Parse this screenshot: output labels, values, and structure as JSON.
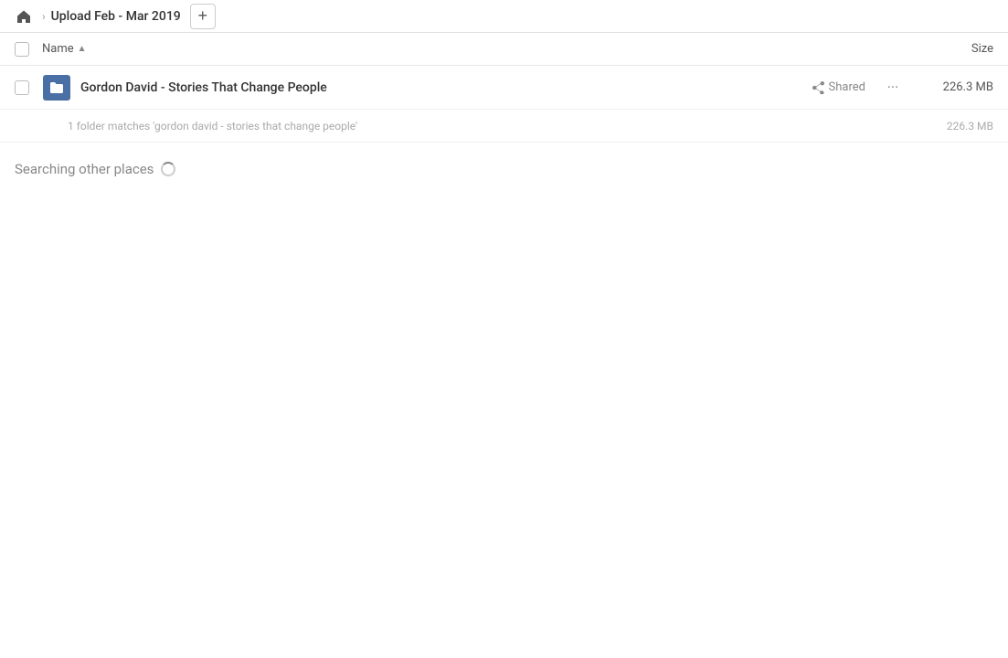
{
  "topbar": {
    "breadcrumb_title": "Upload Feb - Mar 2019",
    "add_button_label": "+"
  },
  "columns": {
    "name_label": "Name",
    "size_label": "Size"
  },
  "file_row": {
    "name": "Gordon David - Stories That Change People",
    "shared_label": "Shared",
    "size": "226.3 MB",
    "more_icon": "···"
  },
  "match_row": {
    "text": "1 folder matches 'gordon david - stories that change people'",
    "size": "226.3 MB"
  },
  "searching": {
    "label": "Searching other places"
  }
}
